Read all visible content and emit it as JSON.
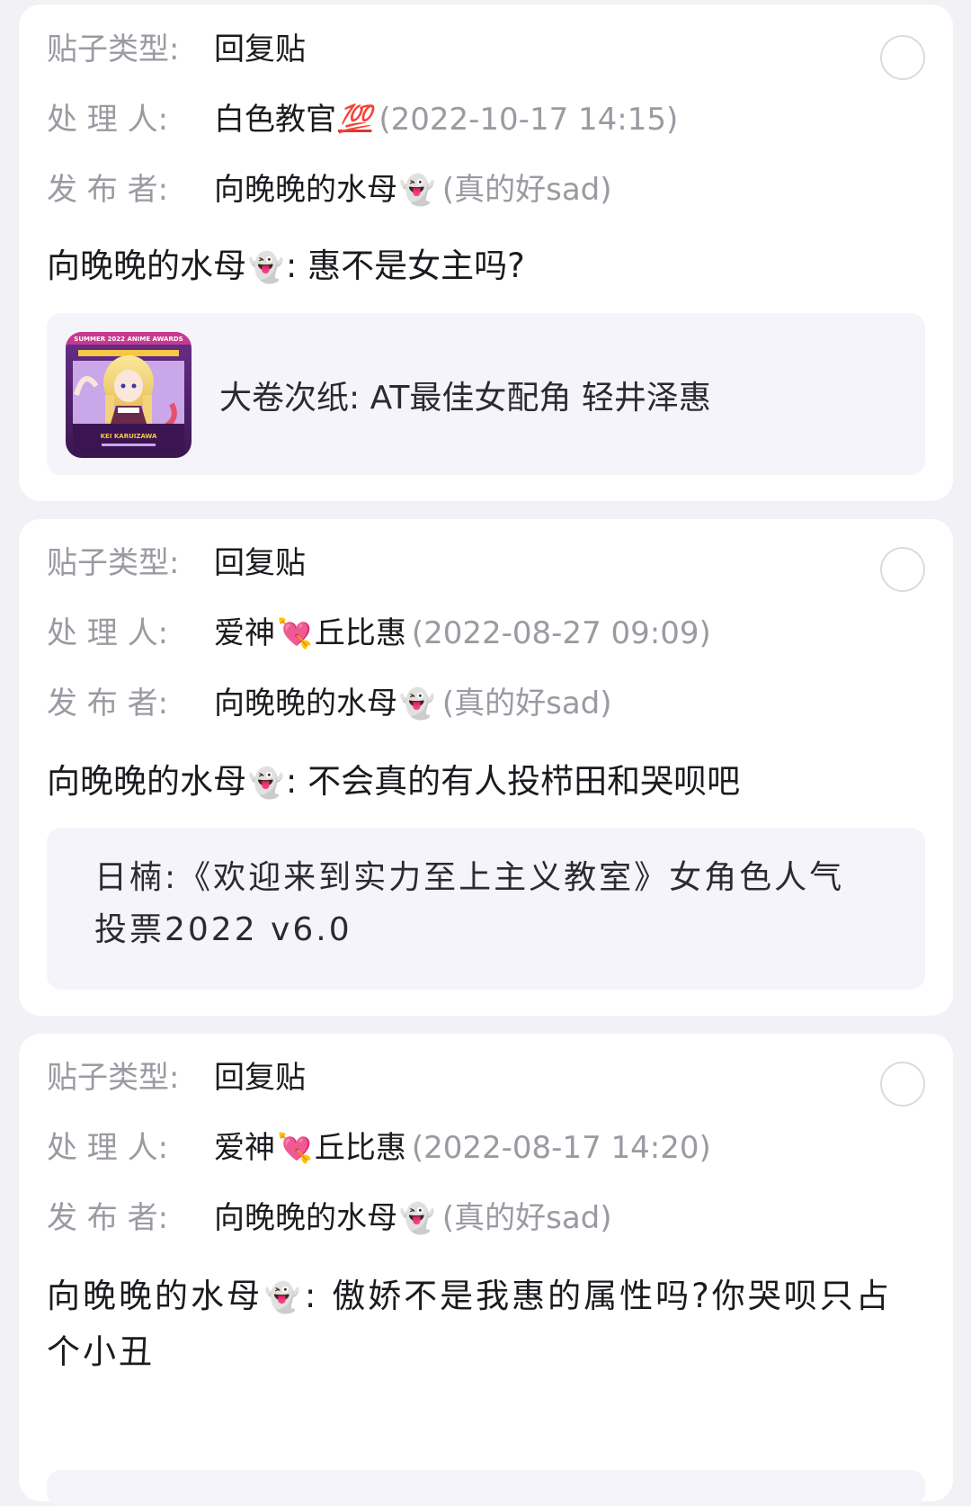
{
  "labels": {
    "type": "贴子类型:",
    "handler": "处 理 人:",
    "publisher": "发 布 者:"
  },
  "colors": {
    "background": "#f1f1f6",
    "card": "#ffffff",
    "label": "#9a9aa2",
    "quote_bg": "#f4f4fa"
  },
  "posts": [
    {
      "type": "回复贴",
      "handler_name": "白色教官",
      "handler_emoji": "💯",
      "handler_time": "(2022-10-17 14:15)",
      "publisher_name": "向晚晚的水母",
      "publisher_emoji": "👻",
      "publisher_note": "(真的好sad)",
      "message_author": "向晚晚的水母",
      "message_emoji": "👻",
      "message_text": ": 惠不是女主吗?",
      "quote_text": "大卷次纸: AT最佳女配角 轻井泽惠",
      "quote_has_image": true,
      "quote_image_icon": "anime-award-thumbnail",
      "quote_image_banner": "SUMMER 2022 ANIME AWARDS",
      "quote_image_caption": "KEI KARUIZAWA"
    },
    {
      "type": "回复贴",
      "handler_name_a": "爱神",
      "handler_emoji": "💘",
      "handler_name_b": "丘比惠",
      "handler_time": "(2022-08-27 09:09)",
      "publisher_name": "向晚晚的水母",
      "publisher_emoji": "👻",
      "publisher_note": "(真的好sad)",
      "message_author": "向晚晚的水母",
      "message_emoji": "👻",
      "message_text": ": 不会真的有人投栉田和哭呗吧",
      "quote_text": "日楠:《欢迎来到实力至上主义教室》女角色人气投票2022 v6.0"
    },
    {
      "type": "回复贴",
      "handler_name_a": "爱神",
      "handler_emoji": "💘",
      "handler_name_b": "丘比惠",
      "handler_time": "(2022-08-17 14:20)",
      "publisher_name": "向晚晚的水母",
      "publisher_emoji": "👻",
      "publisher_note": "(真的好sad)",
      "message_author": "向晚晚的水母",
      "message_emoji": "👻",
      "message_text": ": 傲娇不是我惠的属性吗?你哭呗只占个小丑"
    }
  ]
}
